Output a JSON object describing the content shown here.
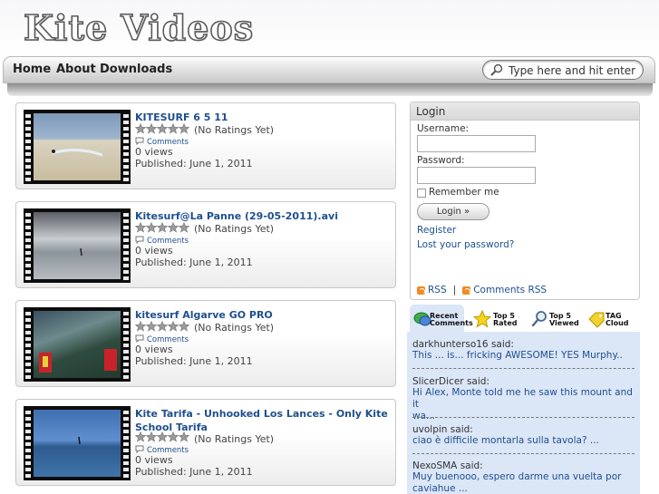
{
  "site": {
    "logo_text": "Kite Videos"
  },
  "nav": {
    "items": [
      "Home",
      "About",
      "Downloads"
    ]
  },
  "search": {
    "placeholder": "Type here and hit enter"
  },
  "videos": [
    {
      "title": "KITESURF 6 5 11",
      "rating_text": "(No Ratings Yet)",
      "comments_label": "Comments",
      "views": "0 views",
      "published": "Published: June 1, 2011"
    },
    {
      "title": "Kitesurf@La Panne (29-05-2011).avi",
      "rating_text": "(No Ratings Yet)",
      "comments_label": "Comments",
      "views": "0 views",
      "published": "Published: June 1, 2011"
    },
    {
      "title": "kitesurf Algarve GO PRO",
      "rating_text": "(No Ratings Yet)",
      "comments_label": "Comments",
      "views": "0 views",
      "published": "Published: June 1, 2011"
    },
    {
      "title_line1": "Kite Tarifa - Unhooked Los Lances - Only Kite",
      "title_line2": "School Tarifa",
      "rating_text": "(No Ratings Yet)",
      "comments_label": "Comments",
      "views": "0 views",
      "published": "Published: June 1, 2011"
    }
  ],
  "login": {
    "heading": "Login",
    "username_label": "Username:",
    "password_label": "Password:",
    "remember_label": "Remember me",
    "button_label": "Login »",
    "register_link": "Register",
    "lost_password_link": "Lost your password?",
    "rss_label": "RSS",
    "separator": "|",
    "comments_rss_label": "Comments RSS"
  },
  "tabs": [
    {
      "line1": "Recent",
      "line2": "Comments",
      "icon": "comments-icon",
      "active": true
    },
    {
      "line1": "Top 5",
      "line2": "Rated",
      "icon": "star-icon",
      "active": false
    },
    {
      "line1": "Top 5",
      "line2": "Viewed",
      "icon": "magnifier-icon",
      "active": false
    },
    {
      "line1": "TAG",
      "line2": "Cloud",
      "icon": "tag-icon",
      "active": false
    }
  ],
  "recent_comments": [
    {
      "author": "darkhunterso16 said:",
      "text": "This ... is... fricking AWESOME! YES Murphy.."
    },
    {
      "author": "SlicerDicer said:",
      "text_line1": "Hi Alex, Monte told me he saw this mount and it",
      "text_line2": "wa..."
    },
    {
      "author": "uvolpin said:",
      "text": "ciao è difficile montarla sulla tavola? ..."
    },
    {
      "author": "NexoSMA said:",
      "text_line1": "Muy buenooo, espero darme una vuelta por",
      "text_line2": "caviahue ..."
    }
  ],
  "colors": {
    "link": "#1f4f8f",
    "tab_active_bg": "#dbe6f7",
    "star": "#9a9a9a",
    "rss": "#f08a24"
  }
}
